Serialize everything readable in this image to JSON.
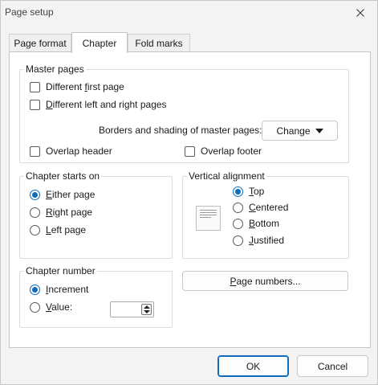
{
  "window": {
    "title": "Page setup"
  },
  "tabs": [
    {
      "label": "Page format",
      "active": false
    },
    {
      "label": "Chapter",
      "active": true
    },
    {
      "label": "Fold marks",
      "active": false
    }
  ],
  "master_pages": {
    "legend": "Master pages",
    "different_first_page": {
      "label_pre": "Different ",
      "label_key": "f",
      "label_post": "irst page",
      "checked": false
    },
    "different_left_right": {
      "label_pre": "",
      "label_key": "D",
      "label_post": "ifferent left and right pages",
      "checked": false
    },
    "borders_label": "Borders and shading of master pages:",
    "change_button": "Change",
    "overlap_header": {
      "label": "Overlap header",
      "checked": false
    },
    "overlap_footer": {
      "label": "Overlap footer",
      "checked": false
    }
  },
  "chapter_starts_on": {
    "legend": "Chapter starts on",
    "options": [
      {
        "key": "E",
        "rest": "ither page",
        "selected": true
      },
      {
        "key": "R",
        "rest": "ight page",
        "selected": false
      },
      {
        "key": "L",
        "rest": "eft page",
        "selected": false
      }
    ]
  },
  "vertical_alignment": {
    "legend": "Vertical alignment",
    "options": [
      {
        "key": "T",
        "rest": "op",
        "selected": true
      },
      {
        "key": "C",
        "rest": "entered",
        "selected": false
      },
      {
        "key": "B",
        "rest": "ottom",
        "selected": false
      },
      {
        "key": "J",
        "rest": "ustified",
        "selected": false
      }
    ]
  },
  "chapter_number": {
    "legend": "Chapter number",
    "increment": {
      "key": "I",
      "rest": "ncrement",
      "selected": true
    },
    "value": {
      "key": "V",
      "rest": "alue:",
      "selected": false,
      "field_value": ""
    }
  },
  "page_numbers_button": {
    "pre": "",
    "key": "P",
    "post": "age numbers..."
  },
  "footer": {
    "ok": "OK",
    "cancel": "Cancel"
  }
}
